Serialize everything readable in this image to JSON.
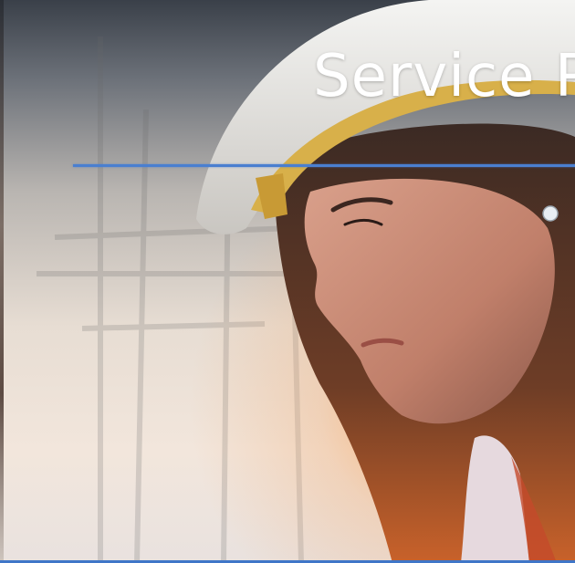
{
  "hero": {
    "title": "Service P",
    "accent_color": "#4a7fd0",
    "bottom_bar_color": "#3f76c8"
  }
}
